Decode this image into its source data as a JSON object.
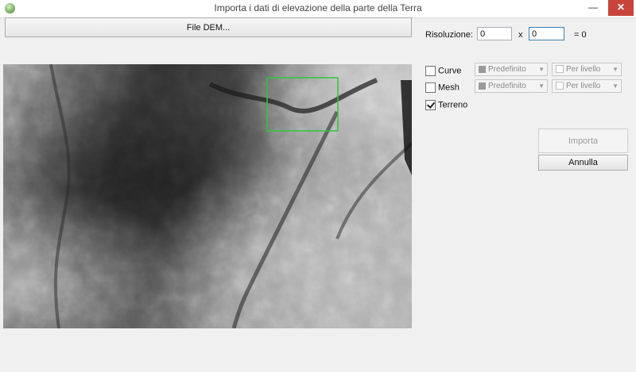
{
  "window": {
    "title": "Importa i dati di elevazione della parte della Terra",
    "minimize_glyph": "—",
    "maximize_glyph": "▢",
    "close_glyph": "✕"
  },
  "dem_button_label": "File DEM...",
  "resolution": {
    "label": "Risoluzione:",
    "width_value": "0",
    "height_value": "0",
    "times": "x",
    "result": "= 0"
  },
  "options": {
    "curve": {
      "label": "Curve",
      "checked": false,
      "style": "Predefinito",
      "mode": "Per livello"
    },
    "mesh": {
      "label": "Mesh",
      "checked": false,
      "style": "Predefinito",
      "mode": "Per livello"
    },
    "terrain": {
      "label": "Terreno",
      "checked": true
    }
  },
  "buttons": {
    "import_label": "Importa",
    "cancel_label": "Annulla"
  },
  "colors": {
    "selection": "#2ec73a",
    "close_button": "#c8443a"
  }
}
